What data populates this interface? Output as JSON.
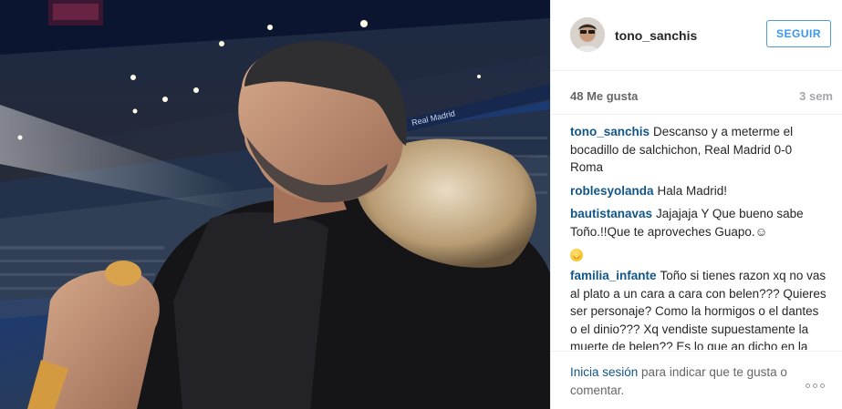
{
  "post": {
    "photo_alt": "Man in black jacket with fur hood eating a sandwich at Santiago Bernabéu stadium",
    "stadium_banner": "Real Madrid"
  },
  "header": {
    "username": "tono_sanchis",
    "follow_label": "SEGUIR"
  },
  "stats": {
    "likes": "48 Me gusta",
    "time_ago": "3 sem"
  },
  "comments": [
    {
      "user": "tono_sanchis",
      "text": "Descanso y a meterme el bocadillo de salchichon, Real Madrid 0-0 Roma"
    },
    {
      "user": "roblesyolanda",
      "text": "Hala Madrid!"
    },
    {
      "user": "bautistanavas",
      "text": "Jajajaja Y Que bueno sabe Toño.!!Que te aproveches Guapo.☺"
    },
    {
      "user": "familia_infante",
      "text": "Toño si tienes razon xq no vas al plato a un cara a cara con belen??? Quieres ser personaje? Como la hormigos o el dantes o el dinio??? Xq vendiste supuestamente la muerte de belen?? Es lo que an dicho en la tele que"
    }
  ],
  "footer": {
    "login_link": "Inicia sesión",
    "login_text": " para indicar que te gusta o comentar."
  },
  "icons": {
    "more": "more-options-icon",
    "emoji": "smiley-emoji-icon"
  }
}
